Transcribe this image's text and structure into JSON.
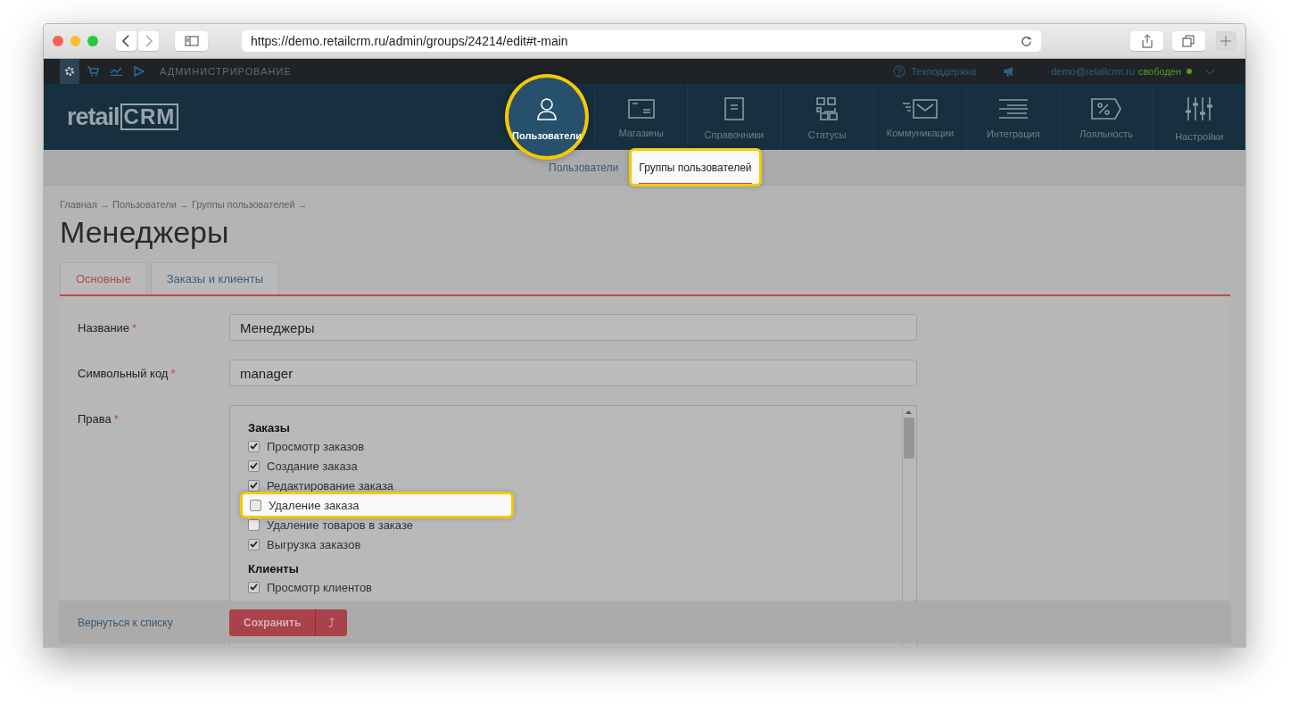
{
  "browser": {
    "url": "https://demo.retailcrm.ru/admin/groups/24214/edit#t-main"
  },
  "topbar": {
    "section": "АДМИНИСТРИРОВАНИЕ",
    "support": "Техподдержка",
    "user_email": "demo@retailcrm.ru",
    "user_status": "свободен"
  },
  "logo": {
    "text": "retail",
    "mark": "CRM"
  },
  "nav": [
    {
      "label": "Пользователи",
      "selected": true
    },
    {
      "label": "Магазины",
      "selected": false
    },
    {
      "label": "Справочники",
      "selected": false
    },
    {
      "label": "Статусы",
      "selected": false
    },
    {
      "label": "Коммуникации",
      "selected": false
    },
    {
      "label": "Интеграция",
      "selected": false
    },
    {
      "label": "Лояльность",
      "selected": false
    },
    {
      "label": "Настройки",
      "selected": false
    }
  ],
  "subnav": [
    {
      "label": "Пользователи",
      "selected": false
    },
    {
      "label": "Группы пользователей",
      "selected": true
    }
  ],
  "breadcrumb": "Главная → Пользователи → Группы пользователей →",
  "title": "Менеджеры",
  "tabs": [
    {
      "label": "Основные",
      "selected": true
    },
    {
      "label": "Заказы и клиенты",
      "selected": false
    }
  ],
  "required_mark": "*",
  "fields": [
    {
      "label": "Название",
      "required": true,
      "value": "Менеджеры"
    },
    {
      "label": "Символьный код",
      "required": true,
      "value": "manager"
    }
  ],
  "permissions": {
    "label": "Права",
    "required": true,
    "groups": [
      {
        "title": "Заказы",
        "items": [
          {
            "label": "Просмотр заказов",
            "checked": true,
            "highlighted": false
          },
          {
            "label": "Создание заказа",
            "checked": true,
            "highlighted": false
          },
          {
            "label": "Редактирование заказа",
            "checked": true,
            "highlighted": false
          },
          {
            "label": "Удаление заказа",
            "checked": false,
            "highlighted": true
          },
          {
            "label": "Удаление товаров в заказе",
            "checked": false,
            "highlighted": false
          },
          {
            "label": "Выгрузка заказов",
            "checked": true,
            "highlighted": false
          }
        ]
      },
      {
        "title": "Клиенты",
        "items": [
          {
            "label": "Просмотр клиентов",
            "checked": true,
            "highlighted": false
          }
        ]
      }
    ]
  },
  "footer": {
    "back_link": "Вернуться к списку",
    "save": "Сохранить",
    "save_menu": "⤴"
  }
}
